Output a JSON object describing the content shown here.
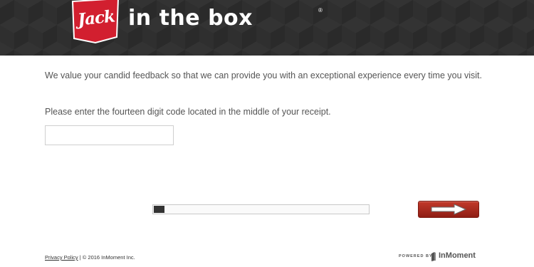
{
  "header": {
    "logo_badge_text": "Jack",
    "logo_brand_text": "in the box",
    "logo_registered_mark": "®",
    "badge_color": "#d21f2f",
    "background_color": "#2a2a2a"
  },
  "main": {
    "intro_text": "We value your candid feedback so that we can provide you with an exceptional experience every time you visit.",
    "instruction_text": "Please enter the fourteen digit code located in the middle of your receipt.",
    "code_input": {
      "value": "",
      "placeholder": ""
    },
    "progress_percent": 5,
    "next_button": {
      "icon": "arrow-right-icon",
      "color": "#a62a1f"
    }
  },
  "footer": {
    "privacy_link_label": "Privacy Policy",
    "copyright_text": " | © 2016 InMoment Inc.",
    "powered_by_label": "POWERED BY",
    "inmoment_label": "InMoment"
  }
}
